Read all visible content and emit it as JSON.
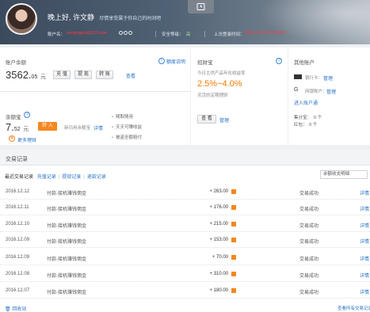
{
  "header": {
    "greeting": "晚上好, 许文静",
    "subtitle": "尽情享受属于你自己的时间吧",
    "account_label": "账户名：",
    "account_value": "wenjingxu@163.com",
    "security_label": "安全等级：",
    "security_value": "高",
    "last_login_label": "上次登录时间：",
    "last_login_value": "2016-12-12 20:00:00"
  },
  "balance": {
    "title": "账户余额",
    "amount_int": "3562.",
    "amount_dec": "05",
    "unit": "元",
    "buttons": [
      "充 值",
      "提 现",
      "转 账"
    ],
    "view_link": "查看",
    "help_link": "额度说明"
  },
  "yuebao": {
    "title": "余额宝",
    "amount_int": "7.",
    "amount_dec": "52",
    "unit": "元",
    "transfer_in": "转 入",
    "note": "新功用余额宝",
    "detail_link": "详情",
    "more_link": "更多理财",
    "features": [
      "随取随用",
      "天天可赚收益",
      "被盗全额赔付"
    ]
  },
  "zhaocai": {
    "title": "招财宝",
    "desc": "今日主供产品年化收益率",
    "rate": "2.5%~4.0%",
    "rate_note": "灵活的定期理财",
    "view_btn": "查 看",
    "manage_link": "管理"
  },
  "other": {
    "title": "其他账户",
    "bank_card_label": "银行卡：",
    "bank_card_link": "管理",
    "wangyin_label": "网银账户：",
    "wangyin_link": "管理",
    "enter_link": "进入账户通",
    "collect_label": "集分宝：",
    "collect_value": "0 个",
    "hongbao_label": "红包：",
    "hongbao_value": "0 个"
  },
  "transactions": {
    "title": "交易记录",
    "filters": [
      "最近交易记录",
      "充值记录",
      "提现记录",
      "退款记录"
    ],
    "select_value": "余额收支明细",
    "rows": [
      {
        "date": "2016.12.12",
        "desc": "付款-接机赚钱佣金",
        "amount": "+ 263.00",
        "status": "交易成功",
        "detail": "详情"
      },
      {
        "date": "2016.12.11",
        "desc": "付款-接机赚钱佣金",
        "amount": "+ 176.00",
        "status": "交易成功",
        "detail": "详情"
      },
      {
        "date": "2016.12.10",
        "desc": "付款-接机赚钱佣金",
        "amount": "+ 215.00",
        "status": "交易成功",
        "detail": "详情"
      },
      {
        "date": "2016.12.09",
        "desc": "付款-接机赚钱佣金",
        "amount": "+ 153.00",
        "status": "交易成功",
        "detail": "详情"
      },
      {
        "date": "2016.12.09",
        "desc": "付款-接机赚钱佣金",
        "amount": "+ 70.00",
        "status": "交易成功",
        "detail": "详情"
      },
      {
        "date": "2016.12.08",
        "desc": "付款-接机赚钱佣金",
        "amount": "+ 310.00",
        "status": "交易成功",
        "detail": "详情"
      },
      {
        "date": "2016.12.07",
        "desc": "付款-接机赚钱佣金",
        "amount": "+ 180.00",
        "status": "交易成功",
        "detail": "详情"
      }
    ],
    "footer_left": "回收站",
    "footer_right": "查看所有交易记录"
  },
  "colors": {
    "accent": "#f5871f",
    "link": "#2a73c6",
    "alert": "#ff3b3b"
  }
}
